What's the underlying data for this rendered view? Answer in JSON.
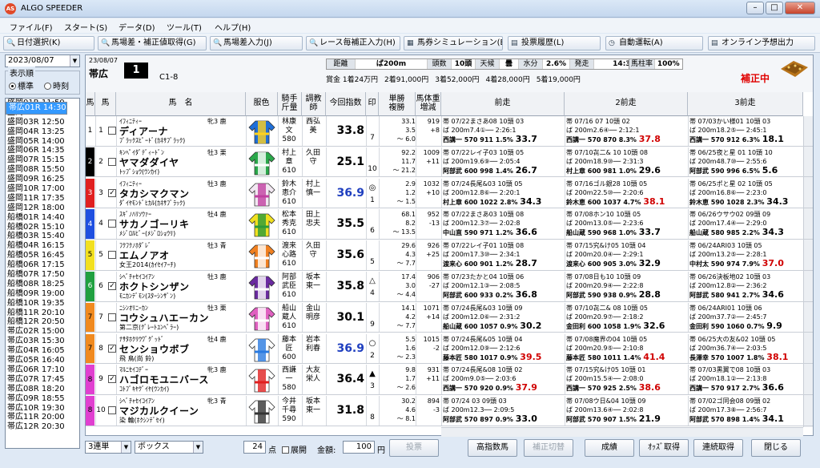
{
  "window": {
    "title": "ALGO SPEEDER",
    "icon": "AS"
  },
  "menu": [
    "ファイル(F)",
    "スタート(S)",
    "データ(D)",
    "ツール(T)",
    "ヘルプ(H)"
  ],
  "toolbar": [
    "日付選択(K)",
    "馬場差・補正値取得(G)",
    "馬場差入力(J)",
    "レース毎補正入力(H)",
    "馬券シミュレーション(B)",
    "投票履歴(L)",
    "自動運転(A)",
    "オンライン予想出力"
  ],
  "left": {
    "date": "2023/08/07",
    "group_label": "表示順",
    "radio_std": "標準",
    "radio_time": "時刻",
    "races": [
      "盛岡01R 11:50",
      "盛岡02R 12:20",
      "盛岡03R 12:50",
      "盛岡04R 13:25",
      "盛岡05R 14:00",
      "盛岡06R 14:35",
      "盛岡07R 15:15",
      "盛岡08R 15:50",
      "盛岡09R 16:25",
      "盛岡10R 17:00",
      "盛岡11R 17:35",
      "盛岡12R 18:00",
      "船橋01R 14:40",
      "船橋02R 15:10",
      "船橋03R 15:40",
      "船橋04R 16:15",
      "船橋05R 16:45",
      "船橋06R 17:15",
      "船橋07R 17:50",
      "船橋08R 18:25",
      "船橋09R 19:00",
      "船橋10R 19:35",
      "船橋11R 20:10",
      "船橋12R 20:50",
      "帯広01R 14:30",
      "帯広02R 15:00",
      "帯広03R 15:30",
      "帯広04R 16:05",
      "帯広05R 16:40",
      "帯広06R 17:10",
      "帯広07R 17:45",
      "帯広08R 18:20",
      "帯広09R 18:55",
      "帯広10R 19:30",
      "帯広11R 20:00",
      "帯広12R 20:30"
    ],
    "selected": 24
  },
  "race": {
    "date": "23/08/07",
    "venue": "帯広",
    "num": "1",
    "class": "C1-8",
    "info": [
      [
        "距離",
        ""
      ],
      [
        "ば200m",
        ""
      ],
      [
        "頭数",
        ""
      ],
      [
        "10頭",
        ""
      ],
      [
        "天候",
        ""
      ],
      [
        "曇",
        ""
      ],
      [
        "水分",
        ""
      ],
      [
        "2.6%",
        ""
      ],
      [
        "発走",
        ""
      ],
      [
        "14:30",
        ""
      ]
    ],
    "prizes": [
      "賞金 1着24万円",
      "2着91,000円",
      "3着52,000円",
      "4着28,000円",
      "5着19,000円"
    ],
    "bachu_label": "馬柱率",
    "bachu_val": "100%",
    "hosei": "補正中"
  },
  "headers": [
    "馬",
    "馬",
    "馬　名",
    "服色",
    "騎手\n斤量",
    "調教\n師",
    "今回指数",
    "印",
    "単勝\n複勝",
    "馬体重\n増減",
    "前走",
    "2前走",
    "3前走"
  ],
  "horses": [
    {
      "waku": "1",
      "wcolor": "#ffffff",
      "wtext": "#000",
      "num": "1",
      "chk": "",
      "sire": "ｲﾌｨﾆﾃｨｰ",
      "name": "ディアーナ",
      "dam": "ﾌﾞﾗｯｸｽﾋﾟｰﾄﾞ(ｶﾈｻﾌﾞﾗｯｸ)",
      "sex": "牝3 鹿",
      "silk": [
        "#1e6fd9",
        "#ffd21e"
      ],
      "jockey": "林康\n文\n580",
      "trainer": "西弘\n美",
      "idx": "33.8",
      "blue": false,
      "mark": "",
      "pop": "7",
      "odds": "33.1\n3.5\n～ 6.0",
      "wt": "919\n+8",
      "p1": [
        "帯 07/22まさあ08 10頭 03",
        "ば 200m7.4①── 2:26:1",
        "西講一 570 911 1.5% 33.7"
      ],
      "p2": [
        "帯 07/16  07 10頭 02",
        "ば 200m2.6④── 2:12:1",
        "西講一 570 870 8.3% 37.8"
      ],
      "p3": [
        "帯 07/03かい様01 10頭 03",
        "ば 200m18.2⑤── 2:45:1",
        "西講一 570 912 6.3% 18.1"
      ]
    },
    {
      "waku": "2",
      "wcolor": "#000000",
      "wtext": "#fff",
      "num": "2",
      "chk": "",
      "sire": "ｷﾝﾍﾟｲﾀﾞﾃﾞｨｰﾄﾞﾝ",
      "name": "ヤマダダイヤ",
      "dam": "ﾄｯﾌﾟｼｮｳ(ｳﾝｶｲ)",
      "sex": "牡3 栗",
      "silk": [
        "#2aa84a",
        "#ffffff"
      ],
      "jockey": "村上\n章\n610",
      "trainer": "久田\n守",
      "idx": "25.1",
      "blue": false,
      "mark": "",
      "pop": "10",
      "odds": "92.2\n11.7\n～ 21.2",
      "wt": "1009\n+11",
      "p1": [
        "帯 07/22レイ子03 10頭 05",
        "ば 200m19.6⑨── 2:05:4",
        "阿部武 600 998 1.4% 26.7"
      ],
      "p2": [
        "帯 07/10㐂二& 10 10頭 08",
        "ば 200m18.9⑩── 2:31:3",
        "村上章 600 981 1.0% 29.6"
      ],
      "p3": [
        "帯 06/25夜と星 01 10頭 10",
        "ば 200m48.7⑩── 2:55:6",
        "阿部武 590 996 6.5% 5.6"
      ]
    },
    {
      "waku": "3",
      "wcolor": "#e02020",
      "wtext": "#fff",
      "num": "3",
      "chk": "✓",
      "sire": "ｲﾌｨﾆﾃｨｰ",
      "name": "タカシマクマン",
      "dam": "ﾀﾞｲﾔﾓﾝﾄﾞﾋｶﾙ(ｶﾈｻﾌﾞﾗｯｸ)",
      "sex": "牡3 鹿",
      "silk": [
        "#f2e8f2",
        "#c040a0"
      ],
      "jockey": "鈴木\n恵介\n610",
      "trainer": "村上\n慎一",
      "idx": "36.9",
      "blue": true,
      "mark": "◎",
      "pop": "1",
      "odds": "2.9\n1.2\n～ 1.5",
      "wt": "1032\n+10",
      "p1": [
        "帯 07/24長尾&03 10頭 05",
        "ば 200m12.8⑥── 2:20:1",
        "村上章 600 1022 2.8% 34.3"
      ],
      "p2": [
        "帯 07/16ゴル銀28 10頭 05",
        "ば 200m22.5⑩── 2:20:6",
        "鈴木恵 600 1037 4.7% 38.1"
      ],
      "p3": [
        "帯 06/25ポと星 02 10頭 05",
        "ば 200m16.8⑥── 2:23:0",
        "鈴木恵 590 1028 2.3% 34.3"
      ]
    },
    {
      "waku": "4",
      "wcolor": "#1f4fe0",
      "wtext": "#fff",
      "num": "4",
      "chk": "",
      "sire": "ｽｷﾞﾉﾊﾘｿｳｧｰ",
      "name": "サカノゴーリキ",
      "dam": "ﾒｼﾞﾛﾙﾋﾞｰ(ﾒｼﾞﾛｼｮｳﾘ)",
      "sex": "牡4 鹿",
      "silk": [
        "#f0e020",
        "#2a9a3a"
      ],
      "jockey": "松本\n秀克\n610",
      "trainer": "田上\n忠夫",
      "idx": "35.5",
      "blue": false,
      "mark": "",
      "pop": "6",
      "odds": "68.1\n8.2\n～ 13.5",
      "wt": "952\n-13",
      "p1": [
        "帯 07/22まさあ03 10頭 08",
        "ば 200m12.3⑦── 2:02:8",
        "中山直 590 971 1.2% 36.6"
      ],
      "p2": [
        "帯 07/08ホン10 10頭 05",
        "ば 200m13.0⑤── 2:23:6",
        "船山蔵 590 968 1.0% 33.7"
      ],
      "p3": [
        "帯 06/26ウサウ02 09頭 09",
        "ば 200m17.4④── 2:29:0",
        "船山蔵 580 985 2.2% 34.3"
      ]
    },
    {
      "waku": "5",
      "wcolor": "#f2e020",
      "wtext": "#000",
      "num": "5",
      "chk": "",
      "sire": "ﾌｸﾌｸﾉﾎﾀﾞﾚﾞ",
      "name": "エムノアオ",
      "dam": "女王2014(ｶｲｾｲｱｰﾁ)",
      "sex": "牡3 青",
      "silk": [
        "#f08020",
        "#ffffff"
      ],
      "jockey": "渡来\n心路\n610",
      "trainer": "久田\n守",
      "idx": "35.6",
      "blue": false,
      "mark": "",
      "pop": "5",
      "odds": "29.6\n4.3\n～ 7.7",
      "wt": "926\n+25",
      "p1": [
        "帯 07/22レイ子01 10頭 08",
        "ば 200m17.3⑩── 2:34:1",
        "渡来心 600 901 1.2% 28.7"
      ],
      "p2": [
        "帯 07/15究&け05 10頭 04",
        "ば 200m20.0④── 2:29:1",
        "渡来心 600 905 3.0% 32.9"
      ],
      "p3": [
        "帯 06/24ARI03 10頭 05",
        "ば 200m13.2⑤── 2:28:1",
        "中村太 590 974 7.9% 37.0"
      ]
    },
    {
      "waku": "6",
      "wcolor": "#20a040",
      "wtext": "#fff",
      "num": "6",
      "chk": "✓",
      "sire": "ｼﾍﾞﾁｬｾｲｺｲｱﾝ",
      "name": "ホクトシンザン",
      "dam": "ﾓﾆｶﾝﾃﾞﾓﾝ(ｽﾀｰｼﾝｻﾞﾝ)",
      "sex": "牡3 鹿",
      "silk": [
        "#6a2aa0",
        "#ffffff"
      ],
      "jockey": "阿部\n武臣\n610",
      "trainer": "坂本\n東一",
      "idx": "35.8",
      "blue": false,
      "mark": "△",
      "pop": "4",
      "odds": "17.4\n3.0\n～ 4.4",
      "wt": "906\n-27",
      "p1": [
        "帯 07/23たかと04 10頭 06",
        "ば 200m12.1③── 2:08:5",
        "阿部武 600 933 0.2% 36.8"
      ],
      "p2": [
        "帯 07/08日も10 10頭 09",
        "ば 200m20.9④── 2:22:8",
        "阿部武 590 938 0.9% 28.8"
      ],
      "p3": [
        "帯 06/26決板地02 10頭 03",
        "ば 200m12.8②── 2:36:2",
        "阿部武 580 941 2.7% 34.6"
      ]
    },
    {
      "waku": "7",
      "wcolor": "#f08a20",
      "wtext": "#000",
      "num": "7",
      "chk": "",
      "sire": "ﾆｼﾝｵﾘﾆｰｶﾝ",
      "name": "コウシュハエーカン",
      "dam": "第二京(ｸﾞﾚｰﾄﾕﾝﾍﾟﾗｰ)",
      "sex": "牡3 栗",
      "silk": [
        "#e060c0",
        "#ffffff"
      ],
      "jockey": "船山\n蔵人\n610",
      "trainer": "金山\n明彦",
      "idx": "30.1",
      "blue": false,
      "mark": "",
      "pop": "9",
      "odds": "14.1\n4.2\n～ 7.7",
      "wt": "1071\n+14",
      "p1": [
        "帯 07/24長尾&03 10頭 09",
        "ば 200m12.0⑥── 2:31:2",
        "船山蔵 600 1057 0.9% 30.2"
      ],
      "p2": [
        "帯 07/10㐂二& 08 10頭 05",
        "ば 200m20.9⑦── 2:18:2",
        "金田利 600 1058 1.9% 32.6"
      ],
      "p3": [
        "帯 06/24ARI01 10頭 06",
        "ば 200m37.7②── 2:45:7",
        "金田利 590 1060 0.7% 9.9"
      ]
    },
    {
      "waku": "7",
      "wcolor": "#f08a20",
      "wtext": "#000",
      "num": "8",
      "chk": "✓",
      "sire": "ﾅｻﾀﾎｸﾘｳﾜﾞｸﾞｯﾄﾞ",
      "name": "センショウボブ",
      "dam": "飛 鳥(尚 鈴)",
      "sex": "牡4 鹿",
      "silk": [
        "#ffffff",
        "#2a7ae0"
      ],
      "jockey": "藤本\n匠\n600",
      "trainer": "岩本\n利春",
      "idx": "36.9",
      "blue": true,
      "mark": "○",
      "pop": "2",
      "odds": "5.5\n1.6\n～ 2.3",
      "wt": "1015\n-2",
      "p1": [
        "帯 07/24長尾&05 10頭 04",
        "ば 200m12.0⑨── 2:12:6",
        "藤本匠 580 1017 0.9% 39.5"
      ],
      "p2": [
        "帯 07/08魔界の04 10頭 05",
        "ば 200m20.9⑤── 2:10:8",
        "藤本匠 580 1011 1.4% 41.4"
      ],
      "p3": [
        "帯 06/25大の友&02 10頭 05",
        "ば 200m36.7④── 2:03:5",
        "長澤幸 570 1007 1.8% 38.1"
      ]
    },
    {
      "waku": "8",
      "wcolor": "#e040d0",
      "wtext": "#000",
      "num": "9",
      "chk": "✓",
      "sire": "ﾏﾙﾆｾｲｺﾃﾞｰ",
      "name": "ハゴロモユニバース",
      "dam": "ｺﾄﾌﾞｷﾔｸﾞｲﾔ(ｳﾝｶｲ)",
      "sex": "牝3 鹿",
      "silk": [
        "#ffffff",
        "#e02020"
      ],
      "jockey": "西謙\n一\n580",
      "trainer": "大友\n栄人",
      "idx": "36.4",
      "blue": false,
      "mark": "▲",
      "pop": "3",
      "odds": "9.8\n1.7\n～ 2.6",
      "wt": "931\n+11",
      "p1": [
        "帯 07/24長尾&08 10頭 02",
        "ば 200m9.0⑤── 2:03:6",
        "西講一 570 920 0.9% 37.9"
      ],
      "p2": [
        "帯 07/15究&け05 10頭 01",
        "ば 200m15.5④── 2:08:0",
        "西講一 570 925 2.5% 38.6"
      ],
      "p3": [
        "帯 07/03黒翼で08 10頭 03",
        "ば 200m18.1②── 2:13:8",
        "西講一 570 917 2.7% 36.6"
      ]
    },
    {
      "waku": "8",
      "wcolor": "#e040d0",
      "wtext": "#000",
      "num": "10",
      "chk": "",
      "sire": "ｼﾍﾞﾁｬｾｲｺｲｱﾝ",
      "name": "マジカルクイーン",
      "dam": "染 輪(ﾎｸｼﾝﾃﾞｾｲ)",
      "sex": "牝3 青",
      "silk": [
        "#ffffff",
        "#333333"
      ],
      "jockey": "今井\n千尋\n590",
      "trainer": "坂本\n東一",
      "idx": "31.8",
      "blue": false,
      "mark": "",
      "pop": "8",
      "odds": "30.2\n4.6\n～ 8.1",
      "wt": "894\n-3",
      "p1": [
        "帯 07/24  03 09頭 03",
        "ば 200m12.3── 2:09:5",
        "阿部武 570 897 0.9% 33.0"
      ],
      "p2": [
        "帯 07/08ウ日&04 10頭 09",
        "ば 200m13.6④── 2:02:8",
        "阿部武 570 907 1.5% 21.9"
      ],
      "p3": [
        "帯 07/02ゴ同会08 09頭 02",
        "ば 200m17.3⑧── 2:56:7",
        "阿部武 570 898 1.4% 34.1"
      ]
    }
  ],
  "bottom": {
    "bet_type": "3連単",
    "bet_mode": "ボックス",
    "points": "24",
    "points_unit": "点",
    "tenkai": "展開",
    "amount_label": "金額:",
    "amount": "100",
    "yen": "円",
    "buttons": [
      "投票",
      "高指数馬",
      "補正切替",
      "成績",
      "ｵｯｽﾞ取得",
      "連続取得",
      "閉じる"
    ]
  }
}
